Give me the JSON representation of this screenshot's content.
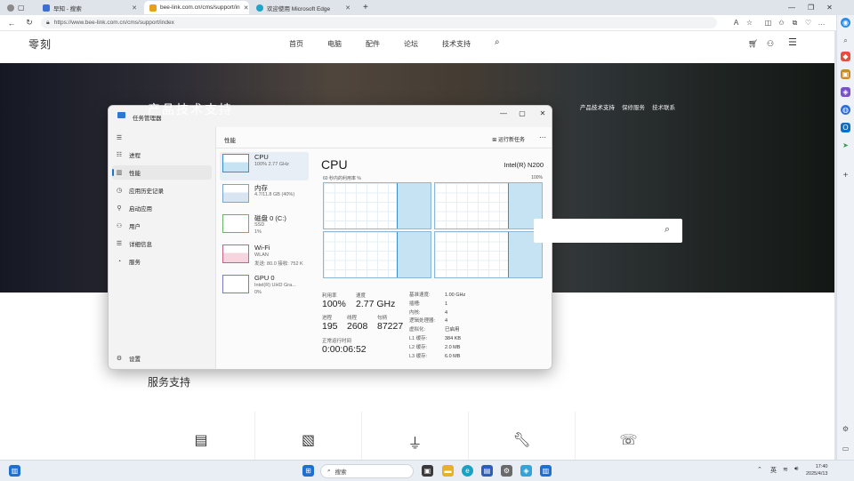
{
  "browser": {
    "tabs": [
      {
        "label": "早知 - 搜索",
        "active": false
      },
      {
        "label": "bee-link.com.cn/cms/support/in",
        "active": true
      },
      {
        "label": "欢迎使用 Microsoft Edge",
        "active": false
      }
    ],
    "url": "https://www.bee-link.com.cn/cms/support/index"
  },
  "site": {
    "logo": "零刻",
    "nav": [
      "首页",
      "电脑",
      "配件",
      "论坛",
      "技术支持"
    ],
    "hero_title": "产品技术支持",
    "hero_links": [
      "产品技术支持",
      "保修服务",
      "技术联系"
    ],
    "section_title": "服务支持"
  },
  "taskmgr": {
    "title": "任务管理器",
    "sidebar": [
      {
        "label": "进程",
        "icon": "processes-icon",
        "glyph": "☷"
      },
      {
        "label": "性能",
        "icon": "performance-icon",
        "glyph": "▥"
      },
      {
        "label": "应用历史记录",
        "icon": "history-icon",
        "glyph": "◷"
      },
      {
        "label": "启动应用",
        "icon": "startup-icon",
        "glyph": "⚲"
      },
      {
        "label": "用户",
        "icon": "users-icon",
        "glyph": "⚇"
      },
      {
        "label": "详细信息",
        "icon": "details-icon",
        "glyph": "☰"
      },
      {
        "label": "服务",
        "icon": "services-icon",
        "glyph": "◔"
      }
    ],
    "settings": "设置",
    "header": "性能",
    "run_task": "运行新任务",
    "perf_items": [
      {
        "title": "CPU",
        "sub1": "100%  2.77 GHz",
        "sub2": ""
      },
      {
        "title": "内存",
        "sub1": "4.7/11.8 GB (40%)",
        "sub2": ""
      },
      {
        "title": "磁盘 0 (C:)",
        "sub1": "SSD",
        "sub2": "1%"
      },
      {
        "title": "Wi-Fi",
        "sub1": "WLAN",
        "sub2": "发送: 80.0  接收: 752 K"
      },
      {
        "title": "GPU 0",
        "sub1": "Intel(R) UHD Gra...",
        "sub2": "0%"
      }
    ],
    "cpu": {
      "heading": "CPU",
      "model": "Intel(R) N200",
      "util_label": "60 秒内的利用率 %",
      "util_max": "100%",
      "stats": [
        {
          "label": "利用率",
          "value": "100%"
        },
        {
          "label": "速度",
          "value": "2.77 GHz"
        },
        {
          "label": "进程",
          "value": "195"
        },
        {
          "label": "线程",
          "value": "2608"
        },
        {
          "label": "句柄",
          "value": "87227"
        },
        {
          "label": "正常运行时间",
          "value": "0:00:06:52"
        }
      ],
      "details": [
        {
          "k": "基准速度:",
          "v": "1.00 GHz"
        },
        {
          "k": "插槽:",
          "v": "1"
        },
        {
          "k": "内核:",
          "v": "4"
        },
        {
          "k": "逻辑处理器:",
          "v": "4"
        },
        {
          "k": "虚拟化:",
          "v": "已启用"
        },
        {
          "k": "L1 缓存:",
          "v": "384 KB"
        },
        {
          "k": "L2 缓存:",
          "v": "2.0 MB"
        },
        {
          "k": "L3 缓存:",
          "v": "6.0 MB"
        }
      ]
    }
  },
  "taskbar": {
    "search": "搜索",
    "lang": "英",
    "time": "17:40",
    "date": "2025/4/13"
  }
}
